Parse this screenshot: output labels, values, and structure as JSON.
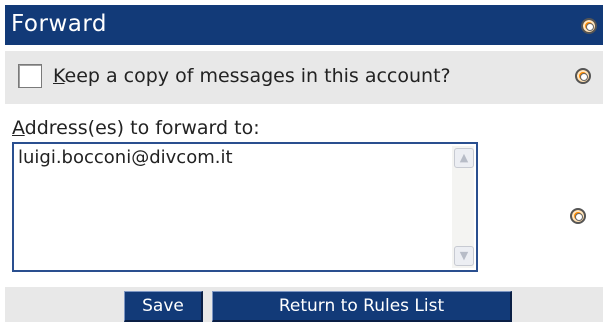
{
  "header": {
    "title": "Forward",
    "help_icon": "lifebuoy-help-icon"
  },
  "keep_copy": {
    "label_accesskey": "K",
    "label_rest": "eep a copy of messages in this account?",
    "checked": false,
    "help_icon": "lifebuoy-help-icon"
  },
  "forward_addresses": {
    "label_accesskey": "A",
    "label_rest": "ddress(es) to forward to:",
    "value": "luigi.bocconi@divcom.it",
    "help_icon": "lifebuoy-help-icon",
    "scroll_up_icon": "chevron-up-icon",
    "scroll_down_icon": "chevron-down-icon"
  },
  "buttons": {
    "save_label": "Save",
    "return_label": "Return to Rules List"
  },
  "colors": {
    "header_bg": "#123a78",
    "row_bg": "#e8e8e8",
    "button_bg": "#123a78",
    "help_icon": "#ff8c00"
  }
}
